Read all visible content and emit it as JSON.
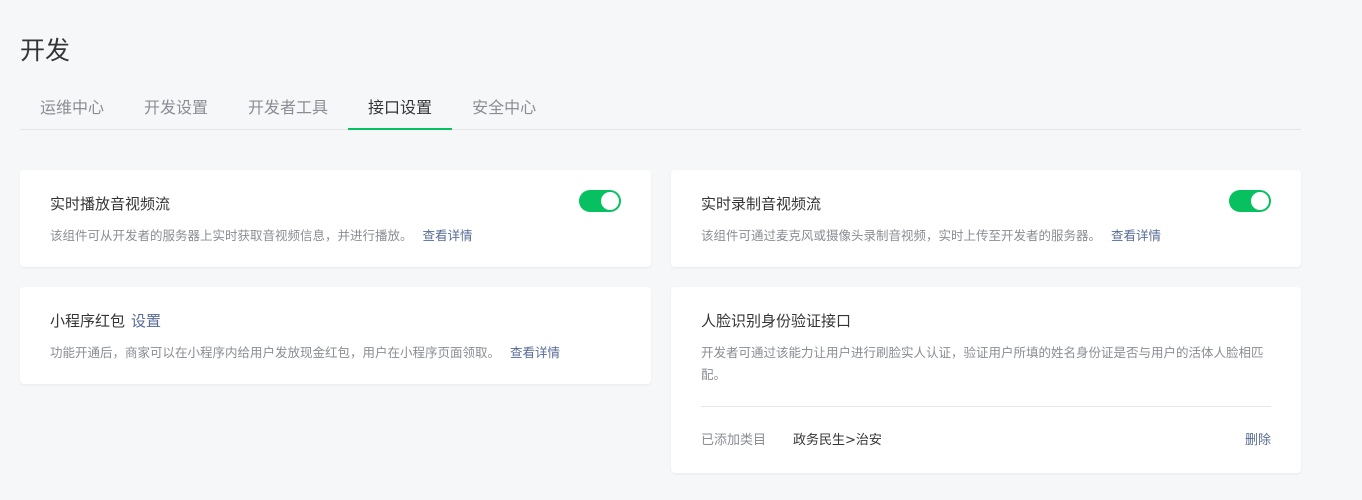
{
  "page": {
    "title": "开发"
  },
  "tabs": [
    {
      "label": "运维中心",
      "active": false
    },
    {
      "label": "开发设置",
      "active": false
    },
    {
      "label": "开发者工具",
      "active": false
    },
    {
      "label": "接口设置",
      "active": true
    },
    {
      "label": "安全中心",
      "active": false
    }
  ],
  "cards": {
    "live_play": {
      "title": "实时播放音视频流",
      "description": "该组件可从开发者的服务器上实时获取音视频信息，并进行播放。",
      "link": "查看详情",
      "toggle_on": true
    },
    "live_record": {
      "title": "实时录制音视频流",
      "description": "该组件可通过麦克风或摄像头录制音视频，实时上传至开发者的服务器。",
      "link": "查看详情",
      "toggle_on": true
    },
    "red_packet": {
      "title": "小程序红包",
      "title_link": "设置",
      "description": "功能开通后，商家可以在小程序内给用户发放现金红包，用户在小程序页面领取。",
      "link": "查看详情"
    },
    "face_verify": {
      "title": "人脸识别身份验证接口",
      "description": "开发者可通过该能力让用户进行刷脸实人认证，验证用户所填的姓名身份证是否与用户的活体人脸相匹配。",
      "category_label": "已添加类目",
      "category_value": "政务民生>治安",
      "delete_label": "删除"
    }
  },
  "colors": {
    "accent": "#07c160",
    "link": "#576b95",
    "background": "#f6f7f9"
  }
}
